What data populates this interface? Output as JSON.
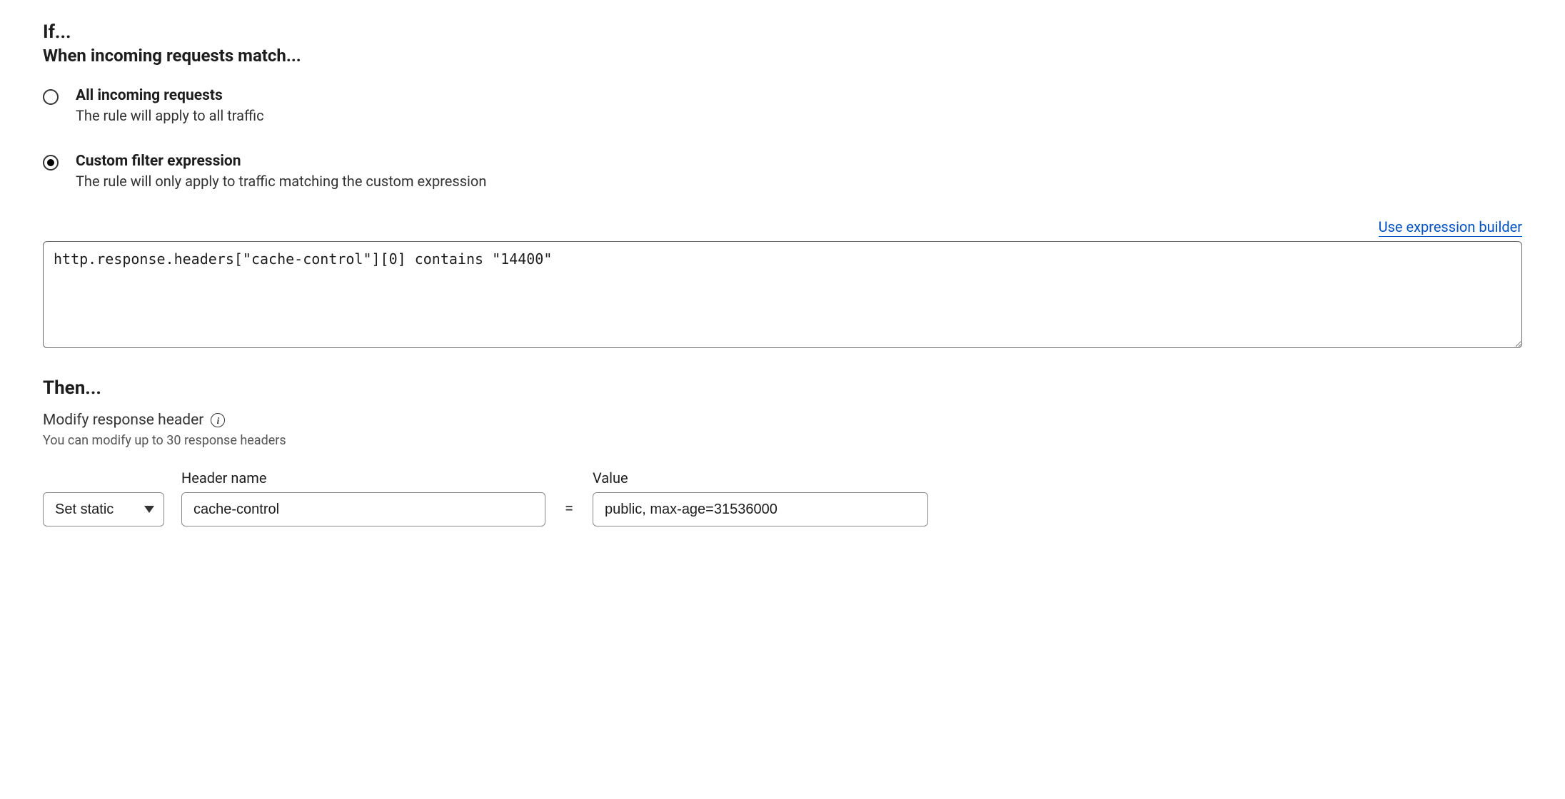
{
  "if_section": {
    "title": "If...",
    "subtitle": "When incoming requests match..."
  },
  "radio_options": {
    "all": {
      "title": "All incoming requests",
      "desc": "The rule will apply to all traffic",
      "selected": false
    },
    "custom": {
      "title": "Custom filter expression",
      "desc": "The rule will only apply to traffic matching the custom expression",
      "selected": true
    }
  },
  "expression": {
    "builder_link": "Use expression builder",
    "value": "http.response.headers[\"cache-control\"][0] contains \"14400\""
  },
  "then_section": {
    "title": "Then...",
    "modify_label": "Modify response header",
    "hint": "You can modify up to 30 response headers"
  },
  "header_config": {
    "action_label_col": "",
    "action_value": "Set static",
    "header_name_label": "Header name",
    "header_name_value": "cache-control",
    "equals": "=",
    "value_label": "Value",
    "value_value": "public, max-age=31536000"
  }
}
